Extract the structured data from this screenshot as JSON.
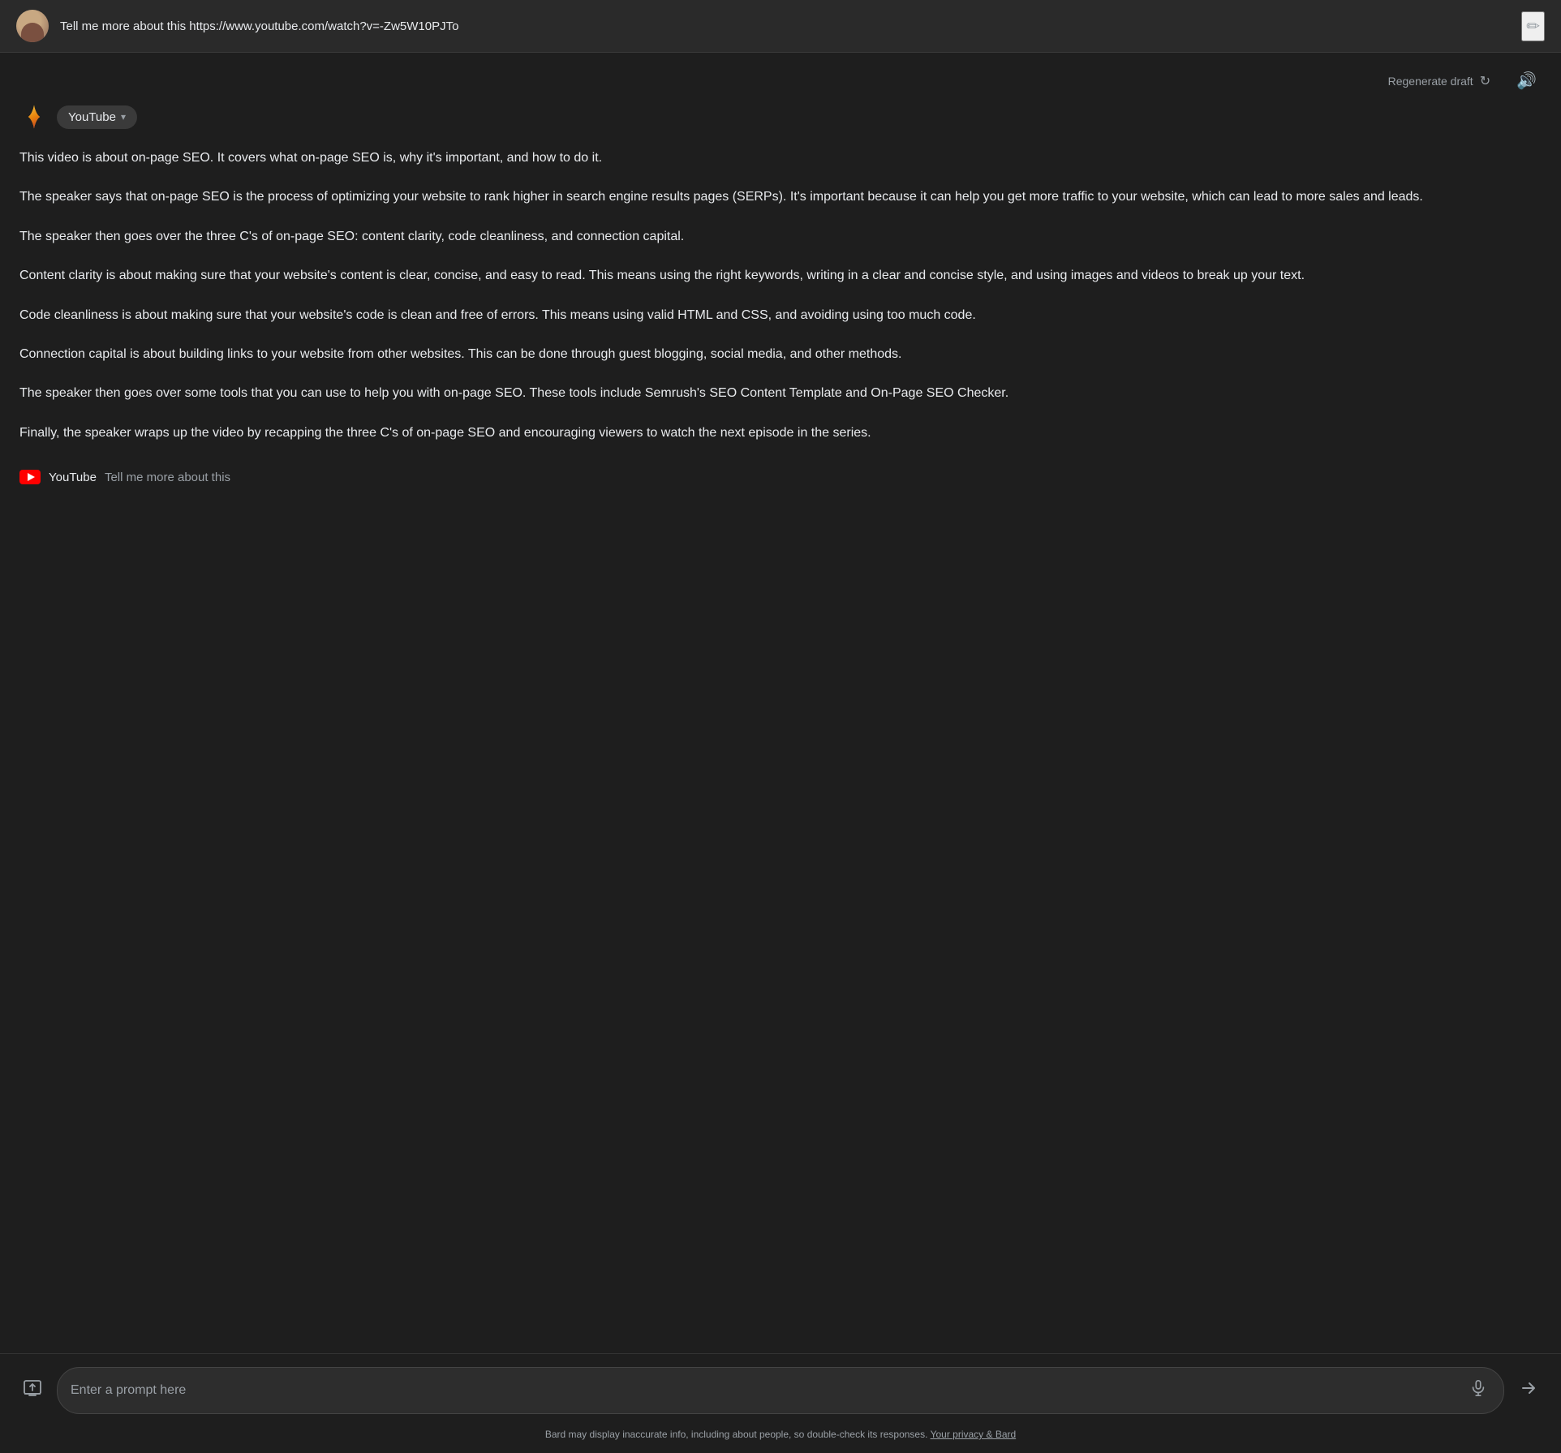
{
  "header": {
    "title": "Tell me more about this https://www.youtube.com/watch?v=-Zw5W10PJTo",
    "edit_icon": "✏"
  },
  "topbar": {
    "regenerate_label": "Regenerate draft",
    "refresh_icon": "↻",
    "volume_icon": "🔊"
  },
  "source_badge": {
    "label": "YouTube",
    "chevron": "▾"
  },
  "response": {
    "paragraphs": [
      "This video is about on-page SEO. It covers what on-page SEO is, why it's important, and how to do it.",
      "The speaker says that on-page SEO is the process of optimizing your website to rank higher in search engine results pages (SERPs). It's important because it can help you get more traffic to your website, which can lead to more sales and leads.",
      "The speaker then goes over the three C's of on-page SEO: content clarity, code cleanliness, and connection capital.",
      "Content clarity is about making sure that your website's content is clear, concise, and easy to read. This means using the right keywords, writing in a clear and concise style, and using images and videos to break up your text.",
      "Code cleanliness is about making sure that your website's code is clean and free of errors. This means using valid HTML and CSS, and avoiding using too much code.",
      "Connection capital is about building links to your website from other websites. This can be done through guest blogging, social media, and other methods.",
      "The speaker then goes over some tools that you can use to help you with on-page SEO. These tools include Semrush's SEO Content Template and On-Page SEO Checker.",
      "Finally, the speaker wraps up the video by recapping the three C's of on-page SEO and encouraging viewers to watch the next episode in the series."
    ]
  },
  "source_reference": {
    "brand": "YouTube",
    "link_text": "Tell me more about this"
  },
  "input": {
    "placeholder": "Enter a prompt here",
    "image_icon": "⊡",
    "mic_icon": "🎤",
    "send_icon": "➤"
  },
  "disclaimer": {
    "text": "Bard may display inaccurate info, including about people, so double-check its responses.",
    "link_text": "Your privacy & Bard"
  }
}
